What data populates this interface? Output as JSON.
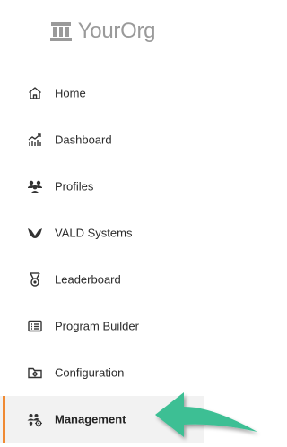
{
  "brand": {
    "name": "YourOrg",
    "icon": "building-columns-icon"
  },
  "nav": {
    "items": [
      {
        "label": "Home",
        "icon": "home-icon"
      },
      {
        "label": "Dashboard",
        "icon": "chart-trend-icon"
      },
      {
        "label": "Profiles",
        "icon": "users-icon"
      },
      {
        "label": "VALD Systems",
        "icon": "vald-logo-icon"
      },
      {
        "label": "Leaderboard",
        "icon": "medal-icon"
      },
      {
        "label": "Program Builder",
        "icon": "list-document-icon"
      },
      {
        "label": "Configuration",
        "icon": "folder-gear-icon"
      },
      {
        "label": "Management",
        "icon": "users-gear-icon"
      }
    ],
    "active_label": "Management"
  },
  "colors": {
    "active_accent": "#f08a33",
    "callout_arrow": "#3dbf94",
    "logo_gray": "#9a9a9a"
  }
}
